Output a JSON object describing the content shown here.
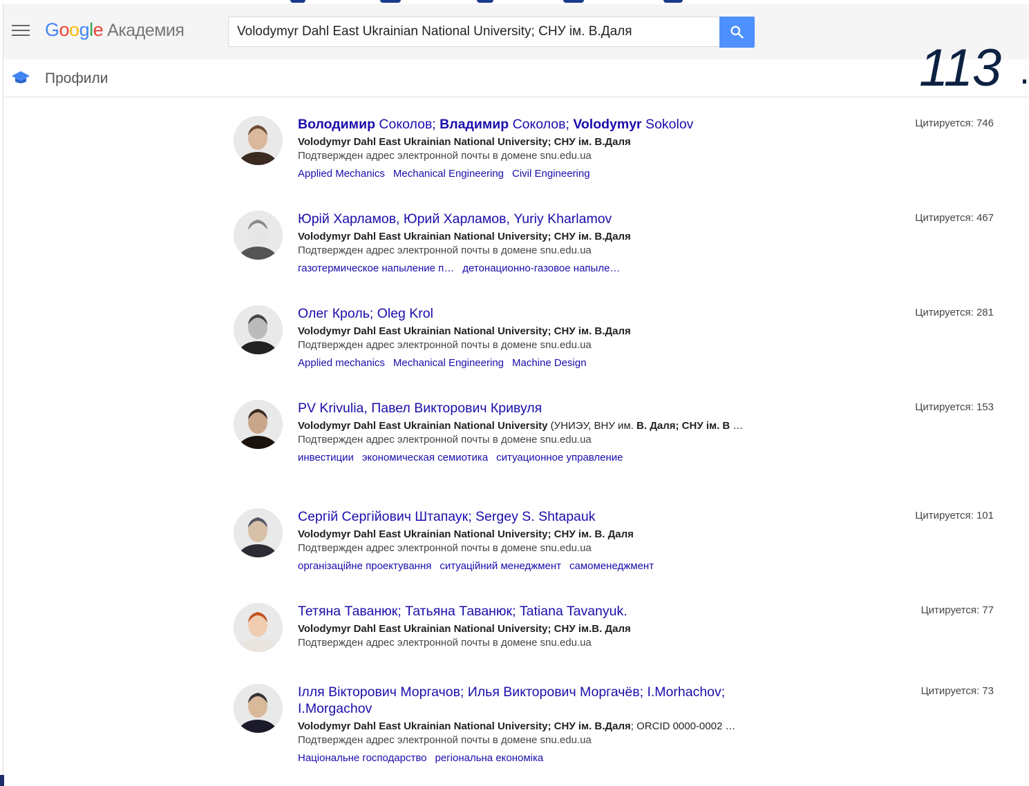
{
  "header": {
    "logo_google": "Google",
    "logo_product": "Академия",
    "search_value": "Volodymyr Dahl East Ukrainian National University; СНУ ім. В.Даля"
  },
  "nav": {
    "profiles_label": "Профили"
  },
  "overlay": {
    "number": "113"
  },
  "colors": {
    "link": "#1a0dab",
    "search_button": "#4d90fe",
    "overlay_text": "#0d2242"
  },
  "results": [
    {
      "name_parts": [
        {
          "t": "Володимир",
          "b": true
        },
        {
          "t": " Соколов; ",
          "b": false
        },
        {
          "t": "Владимир",
          "b": true
        },
        {
          "t": " Соколов; ",
          "b": false
        },
        {
          "t": "Volodymyr",
          "b": true
        },
        {
          "t": " Sokolov",
          "b": false
        }
      ],
      "affil_parts": [
        {
          "t": "Volodymyr Dahl East Ukrainian National University; СНУ ім. В.Даля",
          "b": true
        }
      ],
      "email": "Подтвержден адрес электронной почты в домене snu.edu.ua",
      "tags": [
        "Applied Mechanics",
        "Mechanical Engineering",
        "Civil Engineering"
      ],
      "cited": "Цитируется: 746"
    },
    {
      "name_parts": [
        {
          "t": "Юрій Харламов, Юрий Харламов, Yuriy Kharlamov",
          "b": false
        }
      ],
      "affil_parts": [
        {
          "t": "Volodymyr Dahl East Ukrainian National University; СНУ ім. В.Даля",
          "b": true
        }
      ],
      "email": "Подтвержден адрес электронной почты в домене snu.edu.ua",
      "tags": [
        "газотермическое напыление п…",
        "детонационно-газовое напыле…"
      ],
      "cited": "Цитируется: 467"
    },
    {
      "name_parts": [
        {
          "t": "Олег Кроль; Oleg Krol",
          "b": false
        }
      ],
      "affil_parts": [
        {
          "t": "Volodymyr Dahl East Ukrainian National University; СНУ ім. В.Даля",
          "b": true
        }
      ],
      "email": "Подтвержден адрес электронной почты в домене snu.edu.ua",
      "tags": [
        "Applied mechanics",
        "Mechanical Engineering",
        "Machine Design"
      ],
      "cited": "Цитируется: 281"
    },
    {
      "name_parts": [
        {
          "t": "PV Krivulia, Павел Викторович Кривуля",
          "b": false
        }
      ],
      "affil_parts": [
        {
          "t": "Volodymyr Dahl East Ukrainian National University",
          "b": true
        },
        {
          "t": " (УНИЭУ, ВНУ им. ",
          "b": false
        },
        {
          "t": "В. Даля; СНУ ім. В",
          "b": true
        },
        {
          "t": " …",
          "b": false
        }
      ],
      "email": "Подтвержден адрес электронной почты в домене snu.edu.ua",
      "tags": [
        "инвестиции",
        "экономическая семиотика",
        "ситуационное управление"
      ],
      "cited": "Цитируется: 153"
    },
    {
      "name_parts": [
        {
          "t": "Сергій Сергійович Штапаук; Sergey S. Shtapauk",
          "b": false
        }
      ],
      "affil_parts": [
        {
          "t": "Volodymyr Dahl East Ukrainian National University; СНУ ім. В. Даля",
          "b": true
        }
      ],
      "email": "Подтвержден адрес электронной почты в домене snu.edu.ua",
      "tags": [
        "організаційне проектування",
        "ситуаційний менеджмент",
        "самоменеджмент"
      ],
      "cited": "Цитируется: 101"
    },
    {
      "name_parts": [
        {
          "t": "Тетяна Таванюк; Татьяна Таванюк; Tatiana Tavanyuk.",
          "b": false
        }
      ],
      "affil_parts": [
        {
          "t": "Volodymyr Dahl East Ukrainian National University; СНУ ім.В. Даля",
          "b": true
        }
      ],
      "email": "Подтвержден адрес электронной почты в домене snu.edu.ua",
      "tags": [],
      "cited": "Цитируется: 77"
    },
    {
      "name_parts": [
        {
          "t": "Ілля Вікторович Моргачов; Илья Викторович Моргачёв; I.Morhachov; I.Morgachov",
          "b": false
        }
      ],
      "affil_parts": [
        {
          "t": "Volodymyr Dahl East Ukrainian National University; СНУ ім. В.Даля",
          "b": true
        },
        {
          "t": "; ORCID 0000-0002 …",
          "b": false
        }
      ],
      "email": "Подтвержден адрес электронной почты в домене snu.edu.ua",
      "tags": [
        "Національне господарство",
        "регіональна економіка"
      ],
      "cited": "Цитируется: 73"
    }
  ]
}
